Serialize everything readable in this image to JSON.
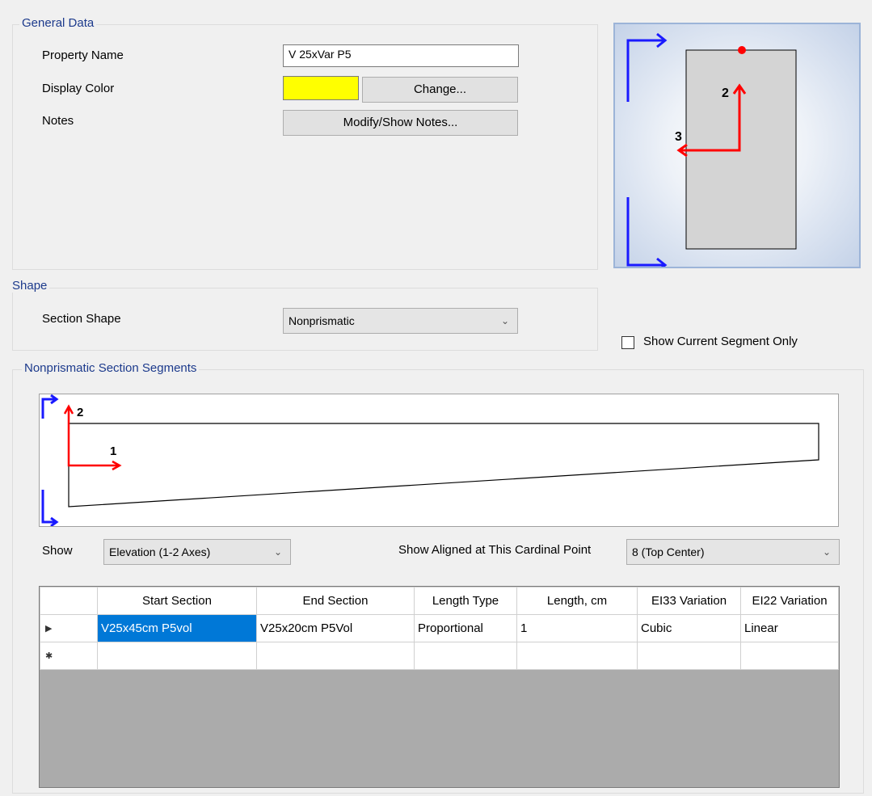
{
  "general": {
    "title": "General Data",
    "property_name_label": "Property Name",
    "property_name_value": "V 25xVar P5",
    "display_color_label": "Display Color",
    "display_color_value": "#ffff00",
    "change_button": "Change...",
    "notes_label": "Notes",
    "notes_button": "Modify/Show Notes..."
  },
  "section_preview": {
    "axis2_label": "2",
    "axis3_label": "3"
  },
  "shape": {
    "title": "Shape",
    "section_shape_label": "Section Shape",
    "section_shape_value": "Nonprismatic"
  },
  "show_current_segment_only": {
    "label": "Show Current Segment Only",
    "checked": false
  },
  "segments": {
    "title": "Nonprismatic Section Segments",
    "elevation": {
      "axis2_label": "2",
      "axis1_label": "1"
    },
    "show_label": "Show",
    "show_value": "Elevation (1-2 Axes)",
    "cardinal_label": "Show Aligned at This Cardinal Point",
    "cardinal_value": "8  (Top Center)",
    "table": {
      "columns": [
        "Start Section",
        "End Section",
        "Length Type",
        "Length, cm",
        "EI33 Variation",
        "EI22 Variation"
      ],
      "rows": [
        {
          "marker": "▶",
          "cells": [
            "V25x45cm P5vol",
            "V25x20cm P5Vol",
            "Proportional",
            "1",
            "Cubic",
            "Linear"
          ]
        },
        {
          "marker": "✱",
          "cells": [
            "",
            "",
            "",
            "",
            "",
            ""
          ]
        }
      ]
    }
  }
}
